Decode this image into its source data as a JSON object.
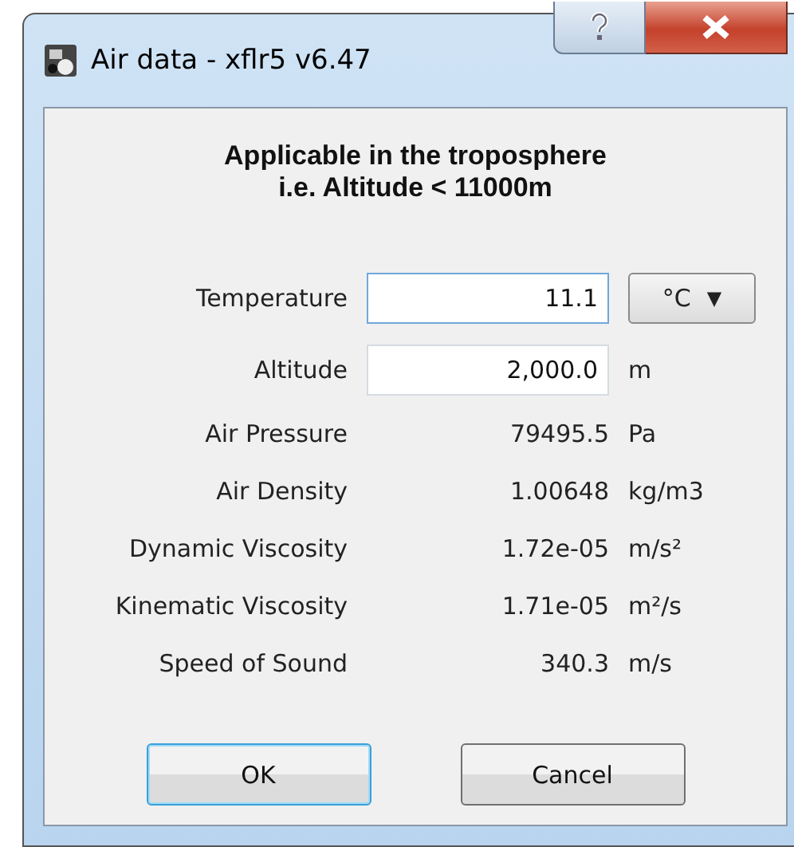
{
  "window": {
    "title": "Air data - xflr5 v6.47"
  },
  "heading": [
    "Applicable in the troposphere",
    "i.e. Altitude < 11000m"
  ],
  "rows": [
    {
      "kind": "input",
      "label": "Temperature",
      "value": "11.1",
      "focused": true,
      "unit": {
        "kind": "dropdown",
        "label": "°C",
        "arrow": "▼"
      }
    },
    {
      "kind": "input",
      "label": "Altitude",
      "value": "2,000.0",
      "focused": false,
      "unit": {
        "kind": "text",
        "label": "m"
      }
    },
    {
      "kind": "readout",
      "label": "Air Pressure",
      "value": "79495.5",
      "unit": "Pa"
    },
    {
      "kind": "readout",
      "label": "Air Density",
      "value": "1.00648",
      "unit": "kg/m3"
    },
    {
      "kind": "readout",
      "label": "Dynamic Viscosity",
      "value": "1.72e-05",
      "unit": "m/s²"
    },
    {
      "kind": "readout",
      "label": "Kinematic Viscosity",
      "value": "1.71e-05",
      "unit": "m²/s"
    },
    {
      "kind": "readout",
      "label": "Speed of Sound",
      "value": "340.3",
      "unit": "m/s"
    }
  ],
  "buttons": [
    {
      "label": "OK",
      "focused": true
    },
    {
      "label": "Cancel",
      "focused": false
    }
  ]
}
